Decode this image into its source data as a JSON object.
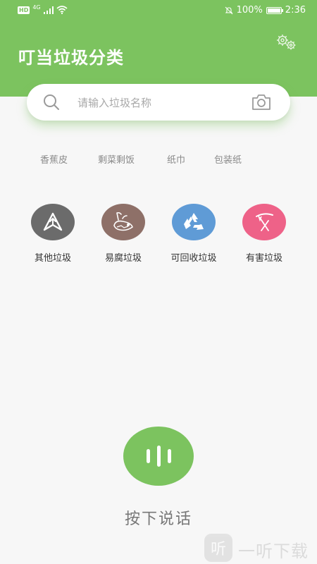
{
  "status_bar": {
    "hd_badge": "HD",
    "network_type": "4G",
    "battery_percent_text": "100%",
    "battery_level": 1.0,
    "time": "2:36"
  },
  "header": {
    "title": "叮当垃圾分类",
    "background_color": "#7cc35f"
  },
  "search": {
    "placeholder": "请输入垃圾名称",
    "value": ""
  },
  "hot_tags": [
    "香蕉皮",
    "剩菜剩饭",
    "纸巾",
    "包装纸"
  ],
  "categories": [
    {
      "label": "其他垃圾",
      "color": "#6b6b6b",
      "icon": "other-waste-icon"
    },
    {
      "label": "易腐垃圾",
      "color": "#8e7068",
      "icon": "food-waste-icon"
    },
    {
      "label": "可回收垃圾",
      "color": "#5f9bd6",
      "icon": "recycle-icon"
    },
    {
      "label": "有害垃圾",
      "color": "#ee6288",
      "icon": "hazardous-waste-icon"
    }
  ],
  "voice": {
    "label": "按下说话",
    "color": "#7cc35f"
  },
  "watermark": {
    "logo_text": "听",
    "text": "一听下载"
  }
}
